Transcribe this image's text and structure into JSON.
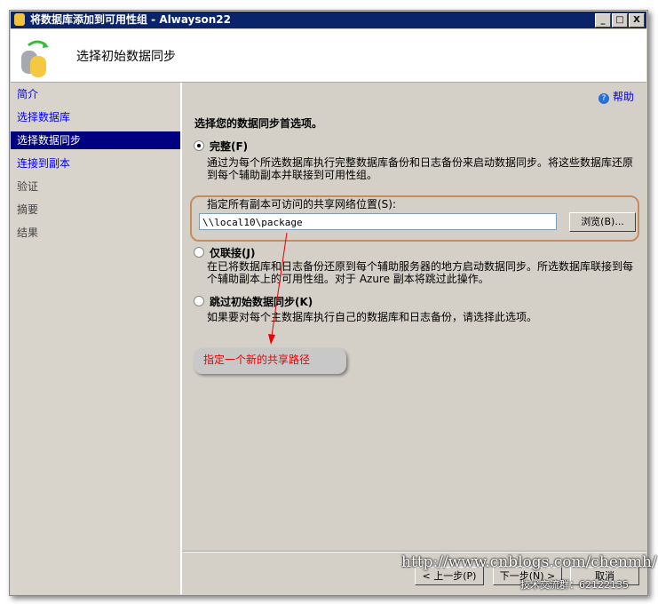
{
  "window": {
    "title": "将数据库添加到可用性组 - Alwayson22",
    "minimize": "_",
    "maximize": "□",
    "close": "X"
  },
  "header": {
    "title": "选择初始数据同步"
  },
  "nav": {
    "items": [
      {
        "label": "简介",
        "state": "link"
      },
      {
        "label": "选择数据库",
        "state": "link"
      },
      {
        "label": "选择数据同步",
        "state": "selected"
      },
      {
        "label": "连接到副本",
        "state": "link"
      },
      {
        "label": "验证",
        "state": "disabled"
      },
      {
        "label": "摘要",
        "state": "disabled"
      },
      {
        "label": "结果",
        "state": "disabled"
      }
    ]
  },
  "main": {
    "help": "帮助",
    "prompt": "选择您的数据同步首选项。",
    "options": [
      {
        "label": "完整(F)",
        "checked": true,
        "desc": "通过为每个所选数据库执行完整数据库备份和日志备份来启动数据同步。将这些数据库还原到每个辅助副本并联接到可用性组。"
      },
      {
        "label": "仅联接(J)",
        "checked": false,
        "desc": "在已将数据库和日志备份还原到每个辅助服务器的地方启动数据同步。所选数据库联接到每个辅助副本上的可用性组。对于 Azure 副本将跳过此操作。"
      },
      {
        "label": "跳过初始数据同步(K)",
        "checked": false,
        "desc": "如果要对每个主数据库执行自己的数据库和日志备份，请选择此选项。"
      }
    ],
    "share_label": "指定所有副本可访问的共享网络位置(S):",
    "share_value": "\\\\local10\\package",
    "browse": "浏览(B)..."
  },
  "footer": {
    "prev": "< 上一步(P)",
    "next": "下一步(N) >",
    "cancel": "取消"
  },
  "annotation": {
    "text": "指定一个新的共享路径",
    "color": "#ee0000"
  },
  "watermark": {
    "url": "http://www.cnblogs.com/chenmh/",
    "group": "技术交流群：62122135"
  }
}
